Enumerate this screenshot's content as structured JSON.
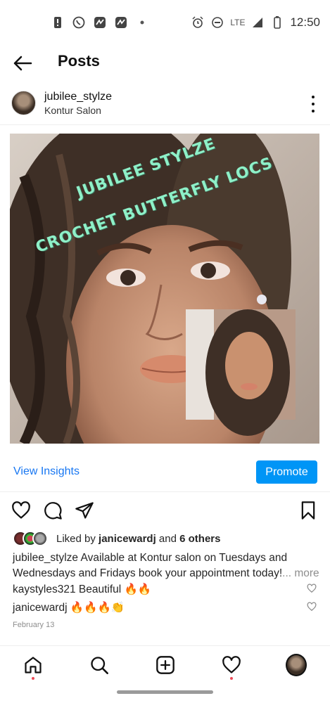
{
  "status_bar": {
    "time": "12:50",
    "network": "LTE",
    "icons": [
      "alert-icon",
      "whatsapp-icon",
      "app-notification-icon",
      "app-notification-icon",
      "dot-icon",
      "alarm-icon",
      "dnd-icon",
      "signal-icon",
      "battery-icon"
    ]
  },
  "header": {
    "title": "Posts",
    "back_icon": "arrow-left-icon"
  },
  "post": {
    "username": "jubilee_stylze",
    "location": "Kontur Salon",
    "image_overlay": {
      "line1": "JUBILEE STYLZE",
      "line2": "CROCHET BUTTERFLY LOCS"
    },
    "insights_label": "View Insights",
    "promote_label": "Promote",
    "likes": {
      "prefix": "Liked by ",
      "user": "janicewardj",
      "connector": " and ",
      "others": "6 others"
    },
    "caption": {
      "user": "jubilee_stylze",
      "text": " Available at Kontur salon on Tuesdays and Wednesdays and Fridays book your appointment today!",
      "more": "... more"
    },
    "comments": [
      {
        "user": "kaystyles321",
        "text": " Beautiful 🔥🔥"
      },
      {
        "user": "janicewardj",
        "text": " 🔥🔥🔥👏"
      }
    ],
    "date": "February 13"
  },
  "bottom_nav": {
    "items": [
      "home-icon",
      "search-icon",
      "create-icon",
      "activity-icon",
      "profile-avatar"
    ]
  },
  "colors": {
    "accent": "#0095f6",
    "link": "#1877f2",
    "notification_dot": "#ed4956",
    "overlay_text": "#8ef0c8"
  }
}
